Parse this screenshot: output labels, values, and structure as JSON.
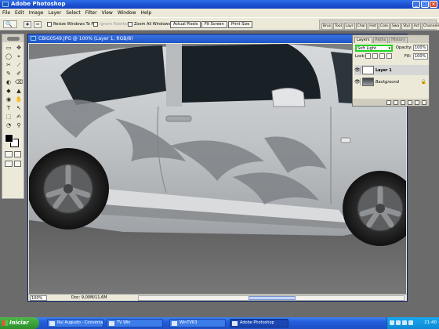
{
  "app": {
    "title": "Adobe Photoshop",
    "window_controls": [
      "_",
      "□",
      "×"
    ]
  },
  "menu": [
    "File",
    "Edit",
    "Image",
    "Layer",
    "Select",
    "Filter",
    "View",
    "Window",
    "Help"
  ],
  "options_bar": {
    "zoom_in": "+",
    "zoom_out": "−",
    "resize_windows": "Resize Windows To Fit",
    "ignore_palettes": "Ignore Palettes",
    "zoom_all_windows": "Zoom All Windows",
    "actual_pixels": "Actual Pixels",
    "fit_screen": "Fit Screen",
    "print_size": "Print Size",
    "palette_well_tabs": [
      "Brus",
      "Tool",
      "Layr",
      "Char",
      "Hist",
      "Colo",
      "Swa",
      "Styl",
      "Act",
      "Channels"
    ]
  },
  "toolbox": {
    "tools": [
      "▭",
      "✥",
      "◯",
      "⌖",
      "✂",
      "⟋",
      "✎",
      "✐",
      "◐",
      "⌫",
      "◆",
      "▲",
      "◉",
      "✋",
      "T",
      "↖",
      "⬚",
      "✍",
      "◔",
      "⚲"
    ]
  },
  "document": {
    "title": "CBIG0549.JPG @ 100% (Layer 1, RGB/8)",
    "zoom": "100%",
    "doc_info": "Doc: 9,00M/11,6M"
  },
  "layers_palette": {
    "tabs": [
      "Layers",
      "Paths",
      "History"
    ],
    "active_tab": "Layers",
    "blend_mode": "Soft Light",
    "opacity_label": "Opacity:",
    "opacity": "100%",
    "lock_label": "Lock:",
    "fill_label": "Fill:",
    "fill": "100%",
    "layers": [
      {
        "name": "Layer 1",
        "selected": true
      },
      {
        "name": "Background",
        "selected": false
      }
    ]
  },
  "taskbar": {
    "start": "Iniciar",
    "tasks": [
      "Rui Augusto - Conversa",
      "TV Win",
      "WinTVR3",
      "Adobe Photoshop"
    ],
    "active_task": "Adobe Photoshop",
    "clock": "21:40"
  },
  "colors": {
    "blend_highlight": "#1fd51f",
    "titlebar_blue": "#1b4fd0",
    "car_silver": "#c4c7ca"
  }
}
